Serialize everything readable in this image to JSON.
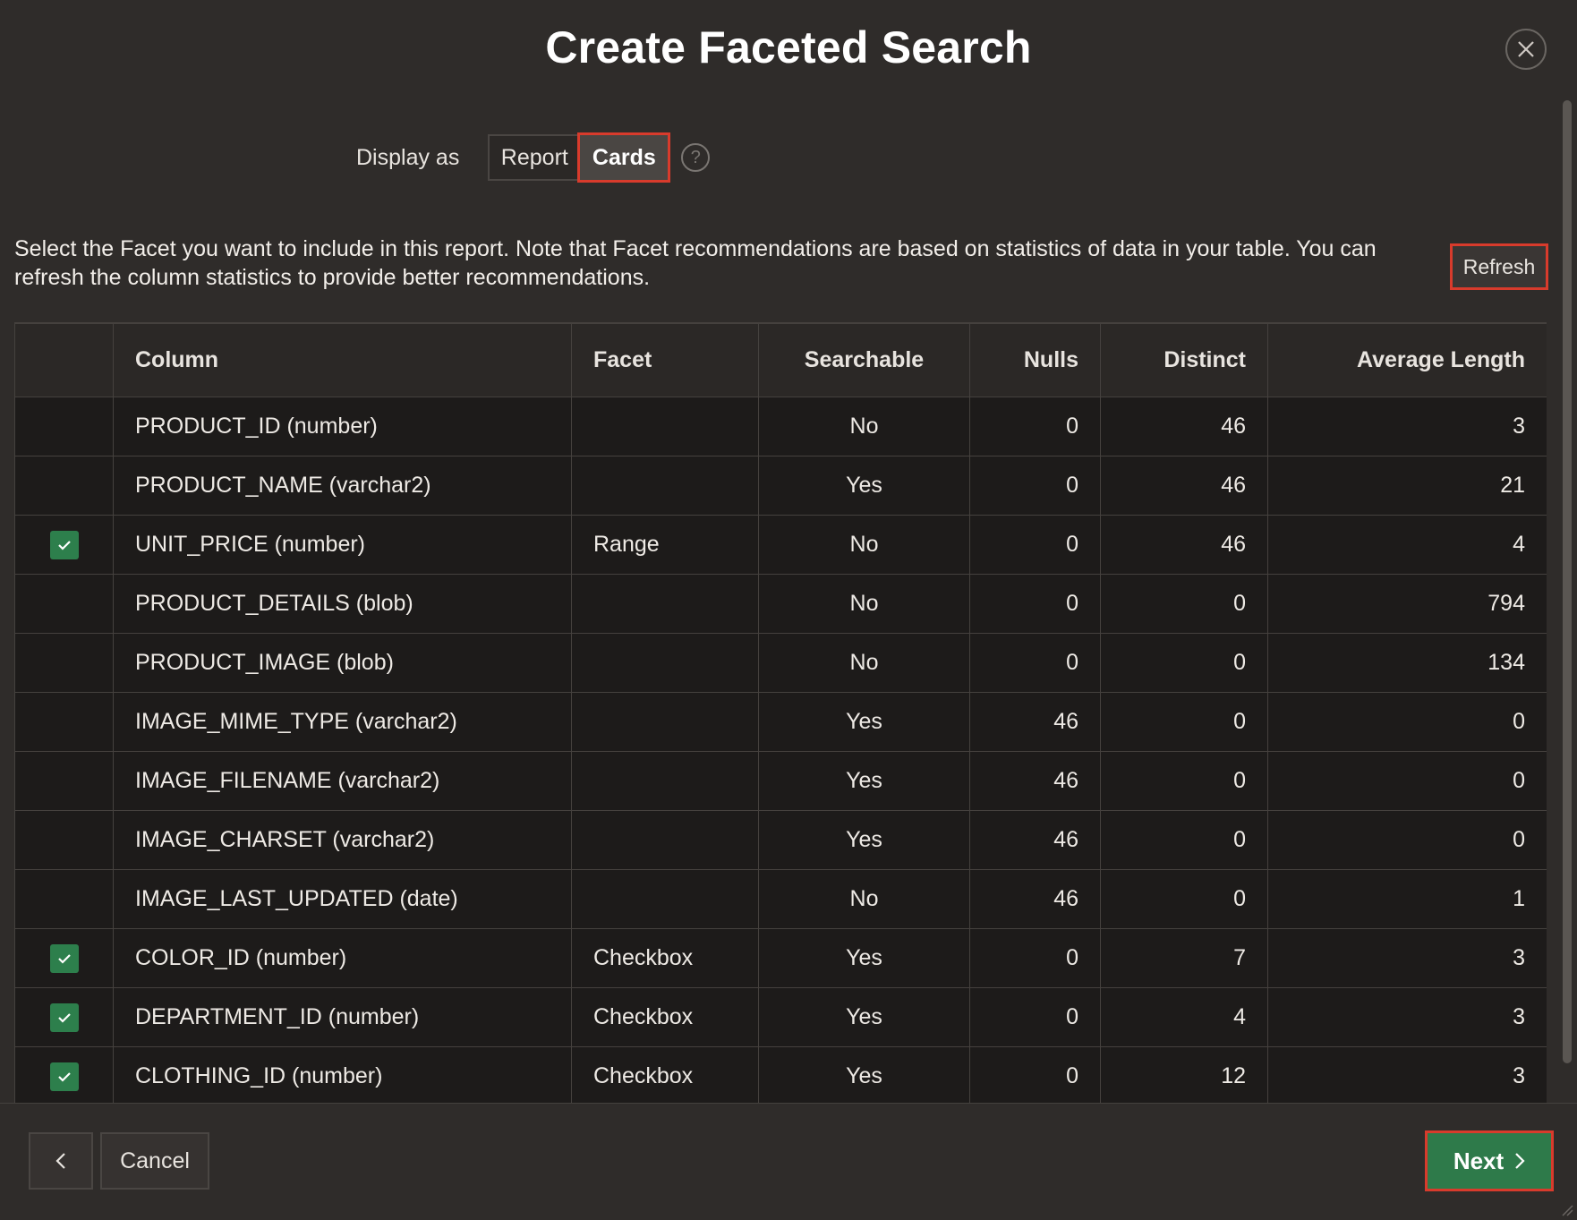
{
  "dialog": {
    "title": "Create Faceted Search",
    "close_icon": "close-icon"
  },
  "display": {
    "label": "Display as",
    "options": [
      "Report",
      "Cards"
    ],
    "selected": "Cards",
    "help_icon": "help-icon"
  },
  "description": "Select the Facet you want to include in this report. Note that Facet recommendations are based on statistics of data in your table. You can refresh the column statistics to provide better recommendations.",
  "refresh_label": "Refresh",
  "table": {
    "headers": [
      "",
      "Column",
      "Facet",
      "Searchable",
      "Nulls",
      "Distinct",
      "Average Length"
    ],
    "rows": [
      {
        "checked": false,
        "column": "PRODUCT_ID (number)",
        "facet": "",
        "searchable": "No",
        "nulls": "0",
        "distinct": "46",
        "avg": "3"
      },
      {
        "checked": false,
        "column": "PRODUCT_NAME (varchar2)",
        "facet": "",
        "searchable": "Yes",
        "nulls": "0",
        "distinct": "46",
        "avg": "21"
      },
      {
        "checked": true,
        "column": "UNIT_PRICE (number)",
        "facet": "Range",
        "searchable": "No",
        "nulls": "0",
        "distinct": "46",
        "avg": "4"
      },
      {
        "checked": false,
        "column": "PRODUCT_DETAILS (blob)",
        "facet": "",
        "searchable": "No",
        "nulls": "0",
        "distinct": "0",
        "avg": "794"
      },
      {
        "checked": false,
        "column": "PRODUCT_IMAGE (blob)",
        "facet": "",
        "searchable": "No",
        "nulls": "0",
        "distinct": "0",
        "avg": "134"
      },
      {
        "checked": false,
        "column": "IMAGE_MIME_TYPE (varchar2)",
        "facet": "",
        "searchable": "Yes",
        "nulls": "46",
        "distinct": "0",
        "avg": "0"
      },
      {
        "checked": false,
        "column": "IMAGE_FILENAME (varchar2)",
        "facet": "",
        "searchable": "Yes",
        "nulls": "46",
        "distinct": "0",
        "avg": "0"
      },
      {
        "checked": false,
        "column": "IMAGE_CHARSET (varchar2)",
        "facet": "",
        "searchable": "Yes",
        "nulls": "46",
        "distinct": "0",
        "avg": "0"
      },
      {
        "checked": false,
        "column": "IMAGE_LAST_UPDATED (date)",
        "facet": "",
        "searchable": "No",
        "nulls": "46",
        "distinct": "0",
        "avg": "1"
      },
      {
        "checked": true,
        "column": "COLOR_ID (number)",
        "facet": "Checkbox",
        "searchable": "Yes",
        "nulls": "0",
        "distinct": "7",
        "avg": "3"
      },
      {
        "checked": true,
        "column": "DEPARTMENT_ID (number)",
        "facet": "Checkbox",
        "searchable": "Yes",
        "nulls": "0",
        "distinct": "4",
        "avg": "3"
      },
      {
        "checked": true,
        "column": "CLOTHING_ID (number)",
        "facet": "Checkbox",
        "searchable": "Yes",
        "nulls": "0",
        "distinct": "12",
        "avg": "3"
      }
    ]
  },
  "footer": {
    "back_icon": "chevron-left-icon",
    "cancel_label": "Cancel",
    "next_label": "Next",
    "next_icon": "chevron-right-icon"
  },
  "colors": {
    "accent_green": "#2e7a4a",
    "highlight_red": "#d83b2c"
  }
}
